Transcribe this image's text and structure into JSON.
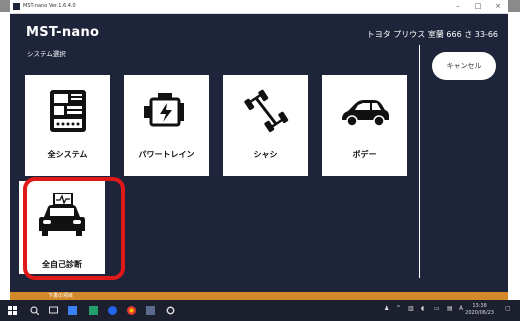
{
  "window": {
    "title": "MST-nano Ver.1.6.4.0",
    "controls": {
      "minimize": "–",
      "maximize": "□",
      "close": "×"
    }
  },
  "header": {
    "brand": "MST-nano",
    "vehicle": "トヨタ プリウス 室蘭 666 さ 33-66"
  },
  "section_label": "システム選択",
  "cancel_button": "キャンセル",
  "tiles": [
    {
      "label": "全システム",
      "icon": "control-panel-icon"
    },
    {
      "label": "パワートレイン",
      "icon": "engine-icon"
    },
    {
      "label": "シャシ",
      "icon": "chassis-icon"
    },
    {
      "label": "ボデー",
      "icon": "car-body-icon"
    },
    {
      "label": "全自己診断",
      "icon": "vehicle-diagnosis-icon",
      "highlighted": true
    }
  ],
  "colors": {
    "window_bg": "#1e2439",
    "highlight": "#e01818",
    "status_bar": "#d3882a"
  },
  "statusbar": {
    "text": "下書の項目"
  },
  "taskbar": {
    "time": "13:38",
    "date": "2020/06/23"
  }
}
